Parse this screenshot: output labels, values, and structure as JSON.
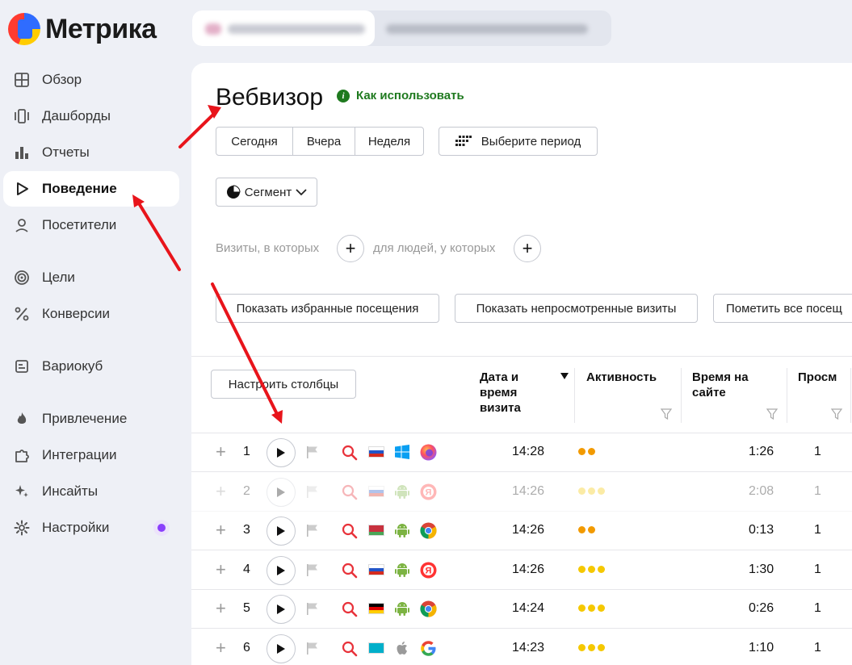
{
  "app": {
    "logo_text": "Метрика"
  },
  "sidebar": {
    "items": [
      {
        "label": "Обзор",
        "icon": "grid-icon"
      },
      {
        "label": "Дашборды",
        "icon": "dashboards-icon"
      },
      {
        "label": "Отчеты",
        "icon": "bar-chart-icon"
      },
      {
        "label": "Поведение",
        "icon": "play-outline-icon",
        "active": true
      },
      {
        "label": "Посетители",
        "icon": "person-icon"
      },
      {
        "label": "Цели",
        "icon": "target-icon"
      },
      {
        "label": "Конверсии",
        "icon": "percent-icon"
      },
      {
        "label": "Вариокуб",
        "icon": "variocube-icon"
      },
      {
        "label": "Привлечение",
        "icon": "flame-icon"
      },
      {
        "label": "Интеграции",
        "icon": "puzzle-icon"
      },
      {
        "label": "Инсайты",
        "icon": "sparkle-icon"
      },
      {
        "label": "Настройки",
        "icon": "gear-icon",
        "badge": true
      }
    ]
  },
  "page": {
    "title": "Вебвизор",
    "howto_label": "Как использовать",
    "periods": [
      "Сегодня",
      "Вчера",
      "Неделя"
    ],
    "choose_period": "Выберите период",
    "segment": "Сегмент",
    "filter_visits": "Визиты, в которых",
    "filter_people": "для людей, у которых",
    "show_favorites": "Показать избранные посещения",
    "show_unwatched": "Показать непросмотренные визиты",
    "mark_all": "Пометить все посещ",
    "configure_columns": "Настроить столбцы"
  },
  "table": {
    "columns": {
      "datetime": [
        "Дата и",
        "время",
        "визита"
      ],
      "activity": "Активность",
      "time_on_site": [
        "Время на",
        "сайте"
      ],
      "views": "Просм"
    },
    "rows": [
      {
        "n": "1",
        "time": "14:28",
        "duration": "1:26",
        "views": "1",
        "country": "russia-flag",
        "os": "windows-icon",
        "browser": "firefox-icon",
        "activity": 2,
        "dim": false
      },
      {
        "n": "2",
        "time": "14:26",
        "duration": "2:08",
        "views": "1",
        "country": "russia-flag",
        "os": "android-icon",
        "browser": "yandex-browser-icon",
        "activity": 3,
        "dim": true
      },
      {
        "n": "3",
        "time": "14:26",
        "duration": "0:13",
        "views": "1",
        "country": "belarus-flag",
        "os": "android-icon",
        "browser": "chrome-icon",
        "activity": 2,
        "dim": false
      },
      {
        "n": "4",
        "time": "14:26",
        "duration": "1:30",
        "views": "1",
        "country": "russia-flag",
        "os": "android-icon",
        "browser": "yandex-browser-icon",
        "activity": 3,
        "dim": false
      },
      {
        "n": "5",
        "time": "14:24",
        "duration": "0:26",
        "views": "1",
        "country": "germany-flag",
        "os": "android-icon",
        "browser": "chrome-icon",
        "activity": 3,
        "dim": false
      },
      {
        "n": "6",
        "time": "14:23",
        "duration": "1:10",
        "views": "1",
        "country": "kazakhstan-flag",
        "os": "apple-icon",
        "browser": "google-icon",
        "activity": 3,
        "dim": false
      }
    ]
  },
  "colors": {
    "accent_green": "#1f7a1f",
    "annotation_red": "#e8141b",
    "activity_orange": "#f29a00",
    "activity_yellow": "#f5c800",
    "search_red": "#e8323a"
  }
}
